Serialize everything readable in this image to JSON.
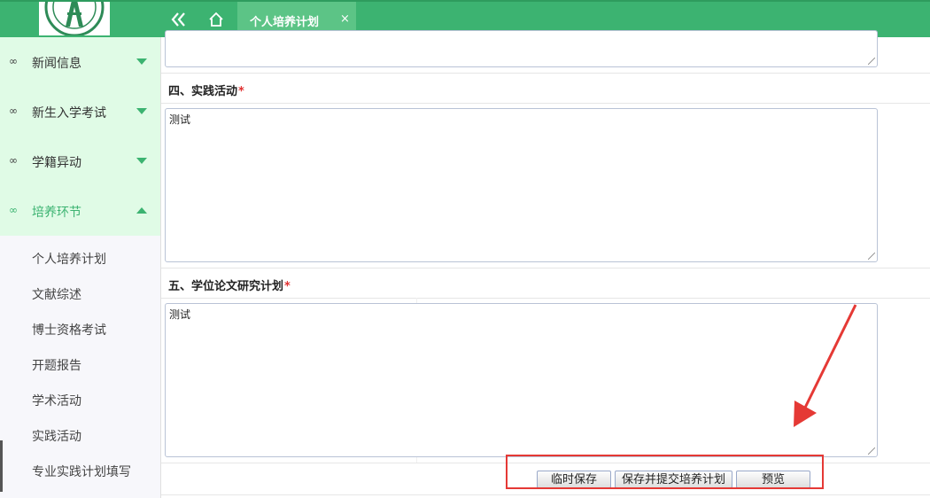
{
  "header": {
    "nav_back_icon": "double-chevron-left-icon",
    "nav_home_icon": "home-icon",
    "tab_label": "个人培养计划",
    "tab_close": "×"
  },
  "sidebar": {
    "menu": [
      {
        "label": "新闻信息",
        "icon": "link-icon",
        "expanded": false
      },
      {
        "label": "新生入学考试",
        "icon": "link-icon",
        "expanded": false
      },
      {
        "label": "学籍异动",
        "icon": "link-icon",
        "expanded": false
      },
      {
        "label": "培养环节",
        "icon": "link-icon",
        "expanded": true
      }
    ],
    "submenu": [
      "个人培养计划",
      "文献综述",
      "博士资格考试",
      "开题报告",
      "学术活动",
      "实践活动",
      "专业实践计划填写"
    ]
  },
  "form": {
    "section4": {
      "title": "四、实践活动",
      "required": "*",
      "value": "测试"
    },
    "section5": {
      "title": "五、学位论文研究计划",
      "required": "*",
      "value": "测试"
    }
  },
  "actions": {
    "temp_save": "临时保存",
    "save_submit": "保存并提交培养计划",
    "preview": "预览"
  },
  "colors": {
    "brand_green": "#3cb371",
    "annotation_red": "#e53935"
  }
}
